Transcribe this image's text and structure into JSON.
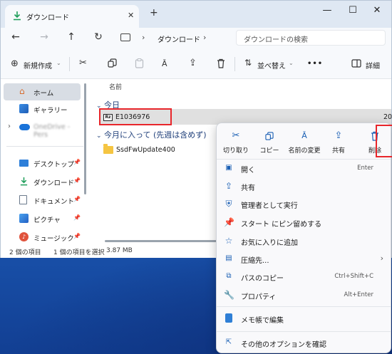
{
  "window": {
    "tab_title": "ダウンロード",
    "close_tab": "✕",
    "new_tab": "+",
    "minimize": "—",
    "maximize": "☐",
    "close": "✕"
  },
  "nav": {
    "back": "←",
    "forward": "→",
    "up": "↑",
    "refresh": "↻",
    "location": "ダウンロード",
    "search_placeholder": "ダウンロードの検索"
  },
  "commandbar": {
    "new_label": "新規作成",
    "sort_label": "並べ替え",
    "more_label": "•••",
    "details_label": "詳細"
  },
  "sidebar": {
    "items": [
      {
        "label": "ホーム",
        "icon": "home-icon"
      },
      {
        "label": "ギャラリー",
        "icon": "gallery-icon"
      },
      {
        "label": "OneDrive - Pers",
        "icon": "cloud-icon"
      },
      {
        "label": "デスクトップ",
        "icon": "desktop-icon"
      },
      {
        "label": "ダウンロード",
        "icon": "download-icon"
      },
      {
        "label": "ドキュメント",
        "icon": "document-icon"
      },
      {
        "label": "ピクチャ",
        "icon": "picture-icon"
      },
      {
        "label": "ミュージック",
        "icon": "music-icon"
      }
    ]
  },
  "content": {
    "column_name": "名前",
    "group_today": "今日",
    "group_month": "今月に入って (先週は含めず)",
    "file_name": "E1036976",
    "file_icon_text": "Rz",
    "file_date": "20",
    "folder_name": "SsdFwUpdate400"
  },
  "status": {
    "count": "2 個の項目",
    "selected": "1 個の項目を選択",
    "size": "3.87 MB"
  },
  "context_menu": {
    "quick_actions": [
      {
        "label": "切り取り",
        "icon": "scissors-icon"
      },
      {
        "label": "コピー",
        "icon": "copy-icon"
      },
      {
        "label": "名前の変更",
        "icon": "rename-icon"
      },
      {
        "label": "共有",
        "icon": "share-icon"
      },
      {
        "label": "削除",
        "icon": "trash-icon"
      }
    ],
    "items": [
      {
        "label": "開く",
        "shortcut": "Enter",
        "icon": "open-icon"
      },
      {
        "label": "共有",
        "shortcut": "",
        "icon": "share-icon"
      },
      {
        "label": "管理者として実行",
        "shortcut": "",
        "icon": "shield-icon"
      },
      {
        "label": "スタート にピン留めする",
        "shortcut": "",
        "icon": "pin-icon"
      },
      {
        "label": "お気に入りに追加",
        "shortcut": "",
        "icon": "star-icon"
      },
      {
        "label": "圧縮先...",
        "shortcut": "",
        "icon": "zip-icon"
      },
      {
        "label": "パスのコピー",
        "shortcut": "Ctrl+Shift+C",
        "icon": "path-copy-icon"
      },
      {
        "label": "プロパティ",
        "shortcut": "Alt+Enter",
        "icon": "wrench-icon"
      },
      {
        "label": "メモ帳で編集",
        "shortcut": "",
        "icon": "notepad-icon"
      },
      {
        "label": "その他のオプションを確認",
        "shortcut": "",
        "icon": "more-options-icon"
      }
    ]
  },
  "colors": {
    "highlight_red": "#e8262b",
    "accent_blue": "#1a5fb4",
    "desktop_blue": "#1d5cb8"
  }
}
